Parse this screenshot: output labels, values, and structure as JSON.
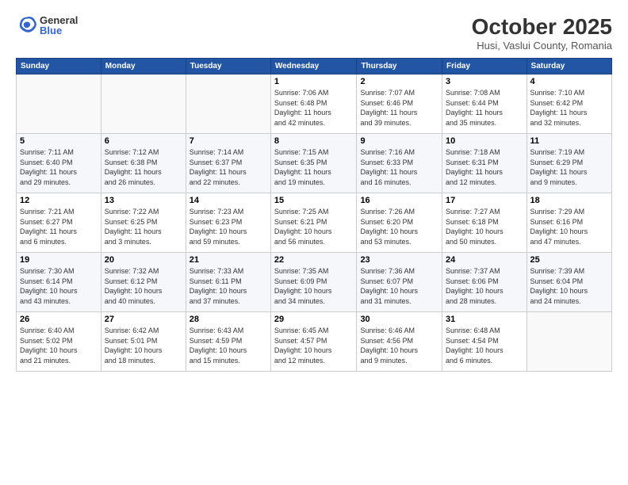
{
  "header": {
    "logo_general": "General",
    "logo_blue": "Blue",
    "month_title": "October 2025",
    "location": "Husi, Vaslui County, Romania"
  },
  "weekdays": [
    "Sunday",
    "Monday",
    "Tuesday",
    "Wednesday",
    "Thursday",
    "Friday",
    "Saturday"
  ],
  "weeks": [
    [
      {
        "day": "",
        "info": ""
      },
      {
        "day": "",
        "info": ""
      },
      {
        "day": "",
        "info": ""
      },
      {
        "day": "1",
        "info": "Sunrise: 7:06 AM\nSunset: 6:48 PM\nDaylight: 11 hours\nand 42 minutes."
      },
      {
        "day": "2",
        "info": "Sunrise: 7:07 AM\nSunset: 6:46 PM\nDaylight: 11 hours\nand 39 minutes."
      },
      {
        "day": "3",
        "info": "Sunrise: 7:08 AM\nSunset: 6:44 PM\nDaylight: 11 hours\nand 35 minutes."
      },
      {
        "day": "4",
        "info": "Sunrise: 7:10 AM\nSunset: 6:42 PM\nDaylight: 11 hours\nand 32 minutes."
      }
    ],
    [
      {
        "day": "5",
        "info": "Sunrise: 7:11 AM\nSunset: 6:40 PM\nDaylight: 11 hours\nand 29 minutes."
      },
      {
        "day": "6",
        "info": "Sunrise: 7:12 AM\nSunset: 6:38 PM\nDaylight: 11 hours\nand 26 minutes."
      },
      {
        "day": "7",
        "info": "Sunrise: 7:14 AM\nSunset: 6:37 PM\nDaylight: 11 hours\nand 22 minutes."
      },
      {
        "day": "8",
        "info": "Sunrise: 7:15 AM\nSunset: 6:35 PM\nDaylight: 11 hours\nand 19 minutes."
      },
      {
        "day": "9",
        "info": "Sunrise: 7:16 AM\nSunset: 6:33 PM\nDaylight: 11 hours\nand 16 minutes."
      },
      {
        "day": "10",
        "info": "Sunrise: 7:18 AM\nSunset: 6:31 PM\nDaylight: 11 hours\nand 12 minutes."
      },
      {
        "day": "11",
        "info": "Sunrise: 7:19 AM\nSunset: 6:29 PM\nDaylight: 11 hours\nand 9 minutes."
      }
    ],
    [
      {
        "day": "12",
        "info": "Sunrise: 7:21 AM\nSunset: 6:27 PM\nDaylight: 11 hours\nand 6 minutes."
      },
      {
        "day": "13",
        "info": "Sunrise: 7:22 AM\nSunset: 6:25 PM\nDaylight: 11 hours\nand 3 minutes."
      },
      {
        "day": "14",
        "info": "Sunrise: 7:23 AM\nSunset: 6:23 PM\nDaylight: 10 hours\nand 59 minutes."
      },
      {
        "day": "15",
        "info": "Sunrise: 7:25 AM\nSunset: 6:21 PM\nDaylight: 10 hours\nand 56 minutes."
      },
      {
        "day": "16",
        "info": "Sunrise: 7:26 AM\nSunset: 6:20 PM\nDaylight: 10 hours\nand 53 minutes."
      },
      {
        "day": "17",
        "info": "Sunrise: 7:27 AM\nSunset: 6:18 PM\nDaylight: 10 hours\nand 50 minutes."
      },
      {
        "day": "18",
        "info": "Sunrise: 7:29 AM\nSunset: 6:16 PM\nDaylight: 10 hours\nand 47 minutes."
      }
    ],
    [
      {
        "day": "19",
        "info": "Sunrise: 7:30 AM\nSunset: 6:14 PM\nDaylight: 10 hours\nand 43 minutes."
      },
      {
        "day": "20",
        "info": "Sunrise: 7:32 AM\nSunset: 6:12 PM\nDaylight: 10 hours\nand 40 minutes."
      },
      {
        "day": "21",
        "info": "Sunrise: 7:33 AM\nSunset: 6:11 PM\nDaylight: 10 hours\nand 37 minutes."
      },
      {
        "day": "22",
        "info": "Sunrise: 7:35 AM\nSunset: 6:09 PM\nDaylight: 10 hours\nand 34 minutes."
      },
      {
        "day": "23",
        "info": "Sunrise: 7:36 AM\nSunset: 6:07 PM\nDaylight: 10 hours\nand 31 minutes."
      },
      {
        "day": "24",
        "info": "Sunrise: 7:37 AM\nSunset: 6:06 PM\nDaylight: 10 hours\nand 28 minutes."
      },
      {
        "day": "25",
        "info": "Sunrise: 7:39 AM\nSunset: 6:04 PM\nDaylight: 10 hours\nand 24 minutes."
      }
    ],
    [
      {
        "day": "26",
        "info": "Sunrise: 6:40 AM\nSunset: 5:02 PM\nDaylight: 10 hours\nand 21 minutes."
      },
      {
        "day": "27",
        "info": "Sunrise: 6:42 AM\nSunset: 5:01 PM\nDaylight: 10 hours\nand 18 minutes."
      },
      {
        "day": "28",
        "info": "Sunrise: 6:43 AM\nSunset: 4:59 PM\nDaylight: 10 hours\nand 15 minutes."
      },
      {
        "day": "29",
        "info": "Sunrise: 6:45 AM\nSunset: 4:57 PM\nDaylight: 10 hours\nand 12 minutes."
      },
      {
        "day": "30",
        "info": "Sunrise: 6:46 AM\nSunset: 4:56 PM\nDaylight: 10 hours\nand 9 minutes."
      },
      {
        "day": "31",
        "info": "Sunrise: 6:48 AM\nSunset: 4:54 PM\nDaylight: 10 hours\nand 6 minutes."
      },
      {
        "day": "",
        "info": ""
      }
    ]
  ]
}
